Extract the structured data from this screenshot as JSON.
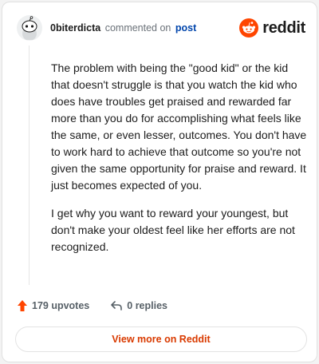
{
  "header": {
    "username": "0biterdicta",
    "action": "commented on",
    "post_link": "post",
    "brand": "reddit"
  },
  "comment": {
    "paragraphs": [
      "The problem with being the \"good kid\" or the kid that doesn't struggle is that you watch the kid who does have troubles get praised and rewarded far more than you do for accomplishing what feels like the same, or even lesser, outcomes. You don't have to work hard to achieve that outcome so you're not given the same opportunity for praise and reward. It just becomes expected of you.",
      "I get why you want to reward your youngest, but don't make your oldest feel like her efforts are not recognized."
    ]
  },
  "actions": {
    "upvotes": "179 upvotes",
    "replies": "0 replies"
  },
  "footer": {
    "view_more": "View more on Reddit"
  },
  "colors": {
    "brand": "#ff4500",
    "link": "#0045ac",
    "cta": "#d93a00"
  }
}
